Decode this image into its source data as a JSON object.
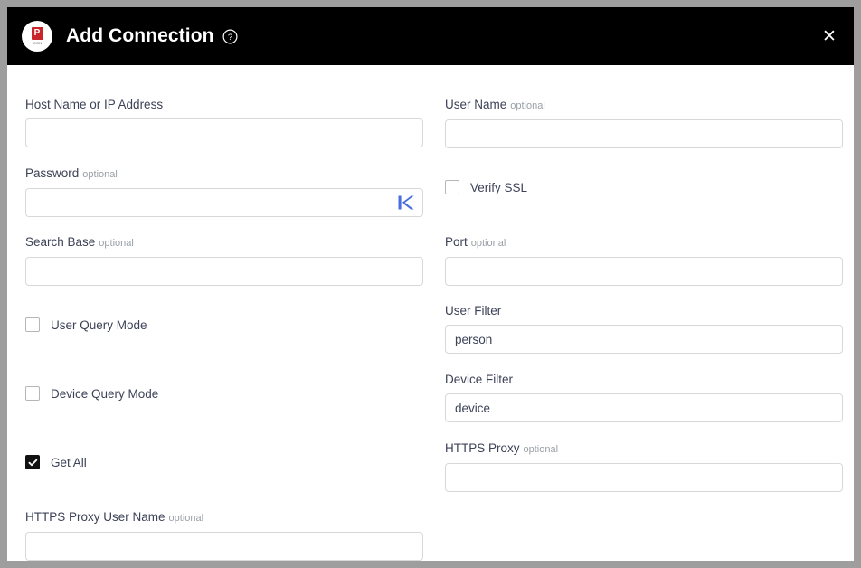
{
  "window": {
    "title": "Add Connection",
    "app_icon": "pcm-app-icon",
    "app_icon_letter": "P",
    "app_icon_sublabel": "ICON",
    "help_icon": "help-circle-icon",
    "close_icon": "close-icon",
    "titlebar_bg": "#000000",
    "title_color": "#ffffff",
    "body_bg": "#ffffff",
    "frame_color": "#9e9e9e"
  },
  "colors": {
    "label": "#3c4257",
    "optional": "#9aa0a6",
    "input_border": "#d8d8d8",
    "checkbox_border": "#b6b6b6",
    "checkbox_checked_bg": "#111111",
    "keeper_blue": "#4a6ee0"
  },
  "form": {
    "optional_suffix": "optional",
    "left": [
      {
        "name": "host-name-or-ip-address",
        "label": "Host Name or IP Address",
        "optional": false,
        "value": "",
        "placeholder": ""
      },
      {
        "name": "password",
        "label": "Password",
        "optional": true,
        "value": "",
        "placeholder": "",
        "trailing_icon": "keeper-k-icon"
      },
      {
        "name": "search-base",
        "label": "Search Base",
        "optional": true,
        "value": "",
        "placeholder": ""
      },
      {
        "name": "https-proxy-user-name",
        "label": "HTTPS Proxy User Name",
        "optional": true,
        "value": "",
        "placeholder": ""
      }
    ],
    "left_checkboxes": [
      {
        "name": "user-query-mode",
        "label": "User Query Mode",
        "checked": false
      },
      {
        "name": "device-query-mode",
        "label": "Device Query Mode",
        "checked": false
      },
      {
        "name": "get-all",
        "label": "Get All",
        "checked": true
      }
    ],
    "right": [
      {
        "name": "user-name",
        "label": "User Name",
        "optional": true,
        "value": "",
        "placeholder": ""
      },
      {
        "name": "port",
        "label": "Port",
        "optional": true,
        "value": "",
        "placeholder": ""
      },
      {
        "name": "user-filter",
        "label": "User Filter",
        "optional": false,
        "value": "person",
        "placeholder": ""
      },
      {
        "name": "device-filter",
        "label": "Device Filter",
        "optional": false,
        "value": "device",
        "placeholder": ""
      },
      {
        "name": "https-proxy",
        "label": "HTTPS Proxy",
        "optional": true,
        "value": "",
        "placeholder": ""
      }
    ],
    "right_checkboxes": [
      {
        "name": "verify-ssl",
        "label": "Verify SSL",
        "checked": false
      }
    ]
  }
}
